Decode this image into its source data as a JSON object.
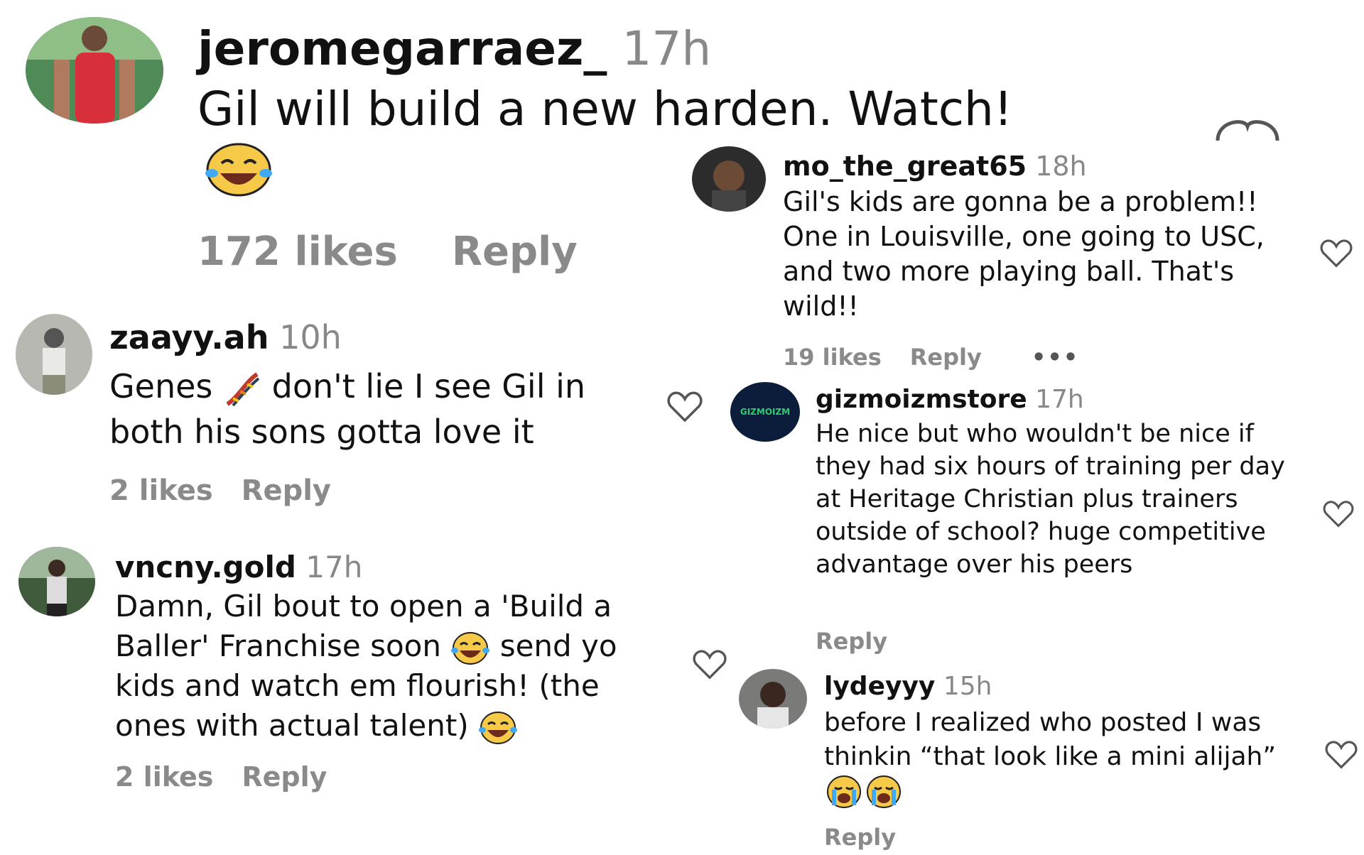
{
  "comments": [
    {
      "username": "jeromegarraez_",
      "time": "17h",
      "text": "Gil will build a new harden. Watch!",
      "likes": "172 likes",
      "reply": "Reply",
      "emoji": "face-with-tears-of-joy-icon"
    },
    {
      "username": "zaayy.ah",
      "time": "10h",
      "text_a": "Genes",
      "text_b": "don't lie I see Gil in both his sons gotta love it",
      "likes": "2 likes",
      "reply": "Reply",
      "emoji": "dna-icon"
    },
    {
      "username": "vncny.gold",
      "time": "17h",
      "text_a": "Damn, Gil bout to open a 'Build a Baller' Franchise soon",
      "text_b": "send yo kids and watch em flourish! (the ones with actual talent)",
      "likes": "2 likes",
      "reply": "Reply"
    },
    {
      "username": "mo_the_great65",
      "time": "18h",
      "text": "Gil's kids are gonna be a problem!! One in Louisville, one going to USC, and two more playing ball. That's wild!!",
      "likes": "19 likes",
      "reply": "Reply",
      "more": "•••"
    },
    {
      "username": "gizmoizmstore",
      "time": "17h",
      "avatar_text": "GIZMOIZM",
      "text": "He nice but who wouldn't be nice if they had six hours of training per day at Heritage Christian plus trainers outside of school? huge competitive advantage over his peers",
      "reply": "Reply"
    },
    {
      "username": "lydeyyy",
      "time": "15h",
      "text": "before I realized who posted I was thinkin “that look like a mini alijah”",
      "reply": "Reply",
      "emoji": "loudly-crying-face-icon"
    }
  ],
  "colors": {
    "text": "#111111",
    "muted": "#8a8a8a",
    "emoji_yellow": "#f7c948",
    "tear_blue": "#3fa9f5",
    "gizmo_bg": "#0b1d3a",
    "gizmo_text": "#2ecc71"
  }
}
